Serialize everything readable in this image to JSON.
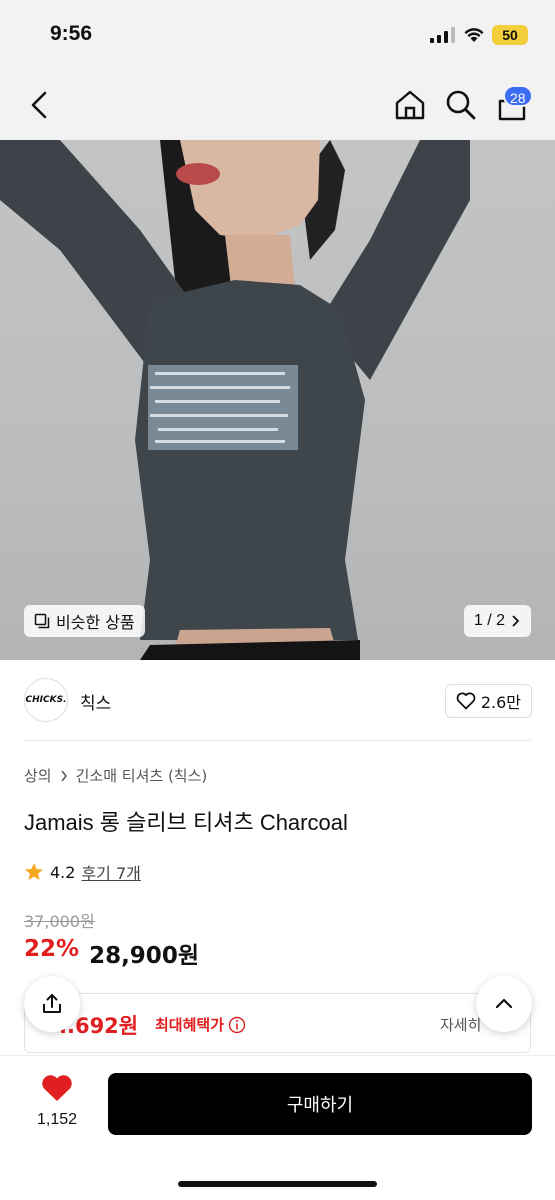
{
  "status_bar": {
    "time": "9:56",
    "battery": "50"
  },
  "nav": {
    "cart_count": "28"
  },
  "gallery": {
    "similar_label": "비슷한 상품",
    "page_indicator": "1 / 2"
  },
  "store": {
    "logo_text": "CHICKS.",
    "name": "칙스",
    "like_count": "2.6만"
  },
  "breadcrumb": {
    "category": "상의",
    "subcategory": "긴소매 티셔츠 (칙스)"
  },
  "product": {
    "title": "Jamais 롱 슬리브 티셔츠 Charcoal",
    "rating": "4.2",
    "review_label": "후기 7개",
    "original_price": "37,000원",
    "discount_rate": "22%",
    "sale_price": "28,900원"
  },
  "benefit": {
    "price": "..692원",
    "label": "최대혜택가",
    "detail": "자세히"
  },
  "bottom": {
    "wish_count": "1,152",
    "buy_label": "구매하기"
  },
  "colors": {
    "accent_red": "#e02020",
    "badge_blue": "#3b6cf6",
    "rating_star": "#f5a623"
  }
}
